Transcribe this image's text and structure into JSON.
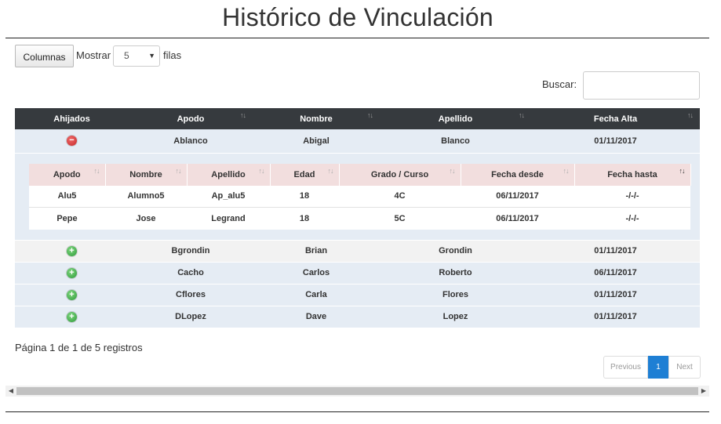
{
  "title": "Histórico de Vinculación",
  "toolbar": {
    "columns_label": "Columnas",
    "show_label": "Mostrar",
    "rows_value": "5",
    "rows_suffix": "filas",
    "search_label": "Buscar:",
    "search_value": ""
  },
  "table": {
    "headers": [
      "Ahijados",
      "Apodo",
      "Nombre",
      "Apellido",
      "Fecha Alta"
    ],
    "rows": [
      {
        "apodo": "Ablanco",
        "nombre": "Abigal",
        "apellido": "Blanco",
        "fecha": "01/11/2017",
        "expanded": true,
        "icon": "minus-circle-icon"
      },
      {
        "apodo": "Bgrondin",
        "nombre": "Brian",
        "apellido": "Grondin",
        "fecha": "01/11/2017",
        "expanded": false,
        "icon": "plus-circle-icon"
      },
      {
        "apodo": "Cacho",
        "nombre": "Carlos",
        "apellido": "Roberto",
        "fecha": "06/11/2017",
        "expanded": false,
        "icon": "plus-circle-icon"
      },
      {
        "apodo": "Cflores",
        "nombre": "Carla",
        "apellido": "Flores",
        "fecha": "01/11/2017",
        "expanded": false,
        "icon": "plus-circle-icon"
      },
      {
        "apodo": "DLopez",
        "nombre": "Dave",
        "apellido": "Lopez",
        "fecha": "01/11/2017",
        "expanded": false,
        "icon": "plus-circle-icon"
      }
    ]
  },
  "child_table": {
    "headers": [
      "Apodo",
      "Nombre",
      "Apellido",
      "Edad",
      "Grado / Curso",
      "Fecha desde",
      "Fecha hasta"
    ],
    "rows": [
      [
        "Alu5",
        "Alumno5",
        "Ap_alu5",
        "18",
        "4C",
        "06/11/2017",
        "-/-/-"
      ],
      [
        "Pepe",
        "Jose",
        "Legrand",
        "18",
        "5C",
        "06/11/2017",
        "-/-/-"
      ]
    ]
  },
  "footer": {
    "info": "Página 1 de 1 de 5 registros",
    "prev_label": "Previous",
    "page_label": "1",
    "next_label": "Next"
  },
  "colors": {
    "header_bg": "#363a3e",
    "child_header_bg": "#f2dede",
    "row_bg": "#e5ecf4",
    "active_page": "#1e7fd4"
  }
}
